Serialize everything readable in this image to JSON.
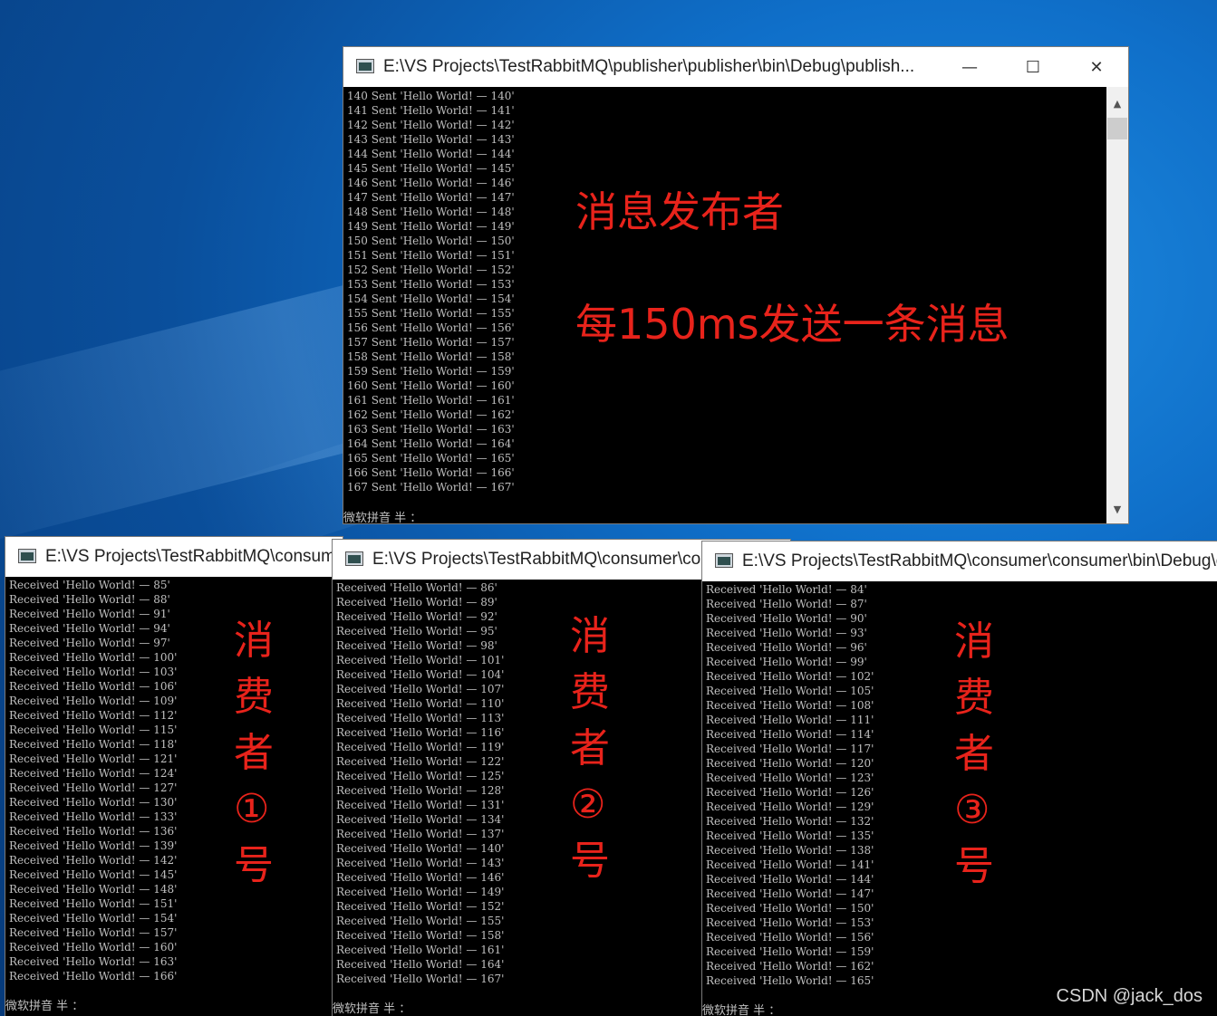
{
  "publisher": {
    "title": "E:\\VS Projects\\TestRabbitMQ\\publisher\\publisher\\bin\\Debug\\publish...",
    "minimize": "—",
    "maximize": "☐",
    "close": "✕",
    "lines": [
      "140 Sent 'Hello World! — 140'",
      "141 Sent 'Hello World! — 141'",
      "142 Sent 'Hello World! — 142'",
      "143 Sent 'Hello World! — 143'",
      "144 Sent 'Hello World! — 144'",
      "145 Sent 'Hello World! — 145'",
      "146 Sent 'Hello World! — 146'",
      "147 Sent 'Hello World! — 147'",
      "148 Sent 'Hello World! — 148'",
      "149 Sent 'Hello World! — 149'",
      "150 Sent 'Hello World! — 150'",
      "151 Sent 'Hello World! — 151'",
      "152 Sent 'Hello World! — 152'",
      "153 Sent 'Hello World! — 153'",
      "154 Sent 'Hello World! — 154'",
      "155 Sent 'Hello World! — 155'",
      "156 Sent 'Hello World! — 156'",
      "157 Sent 'Hello World! — 157'",
      "158 Sent 'Hello World! — 158'",
      "159 Sent 'Hello World! — 159'",
      "160 Sent 'Hello World! — 160'",
      "161 Sent 'Hello World! — 161'",
      "162 Sent 'Hello World! — 162'",
      "163 Sent 'Hello World! — 163'",
      "164 Sent 'Hello World! — 164'",
      "165 Sent 'Hello World! — 165'",
      "166 Sent 'Hello World! — 166'",
      "167 Sent 'Hello World! — 167'"
    ],
    "ime": "微软拼音 半 ：",
    "annotation_title": "消息发布者",
    "annotation_desc": "每150ms发送一条消息"
  },
  "consumer1": {
    "title": "E:\\VS Projects\\TestRabbitMQ\\consumer\\consumer\\bin\\Debug\\consumer.exe",
    "lines": [
      "Received 'Hello World! — 85'",
      "Received 'Hello World! — 88'",
      "Received 'Hello World! — 91'",
      "Received 'Hello World! — 94'",
      "Received 'Hello World! — 97'",
      "Received 'Hello World! — 100'",
      "Received 'Hello World! — 103'",
      "Received 'Hello World! — 106'",
      "Received 'Hello World! — 109'",
      "Received 'Hello World! — 112'",
      "Received 'Hello World! — 115'",
      "Received 'Hello World! — 118'",
      "Received 'Hello World! — 121'",
      "Received 'Hello World! — 124'",
      "Received 'Hello World! — 127'",
      "Received 'Hello World! — 130'",
      "Received 'Hello World! — 133'",
      "Received 'Hello World! — 136'",
      "Received 'Hello World! — 139'",
      "Received 'Hello World! — 142'",
      "Received 'Hello World! — 145'",
      "Received 'Hello World! — 148'",
      "Received 'Hello World! — 151'",
      "Received 'Hello World! — 154'",
      "Received 'Hello World! — 157'",
      "Received 'Hello World! — 160'",
      "Received 'Hello World! — 163'",
      "Received 'Hello World! — 166'"
    ],
    "ime": "微软拼音 半 ：",
    "annotation": [
      "消",
      "费",
      "者",
      "①",
      "号"
    ]
  },
  "consumer2": {
    "title": "E:\\VS Projects\\TestRabbitMQ\\consumer\\consumer\\bin\\Debug\\consumer.exe",
    "lines": [
      "Received 'Hello World! — 86'",
      "Received 'Hello World! — 89'",
      "Received 'Hello World! — 92'",
      "Received 'Hello World! — 95'",
      "Received 'Hello World! — 98'",
      "Received 'Hello World! — 101'",
      "Received 'Hello World! — 104'",
      "Received 'Hello World! — 107'",
      "Received 'Hello World! — 110'",
      "Received 'Hello World! — 113'",
      "Received 'Hello World! — 116'",
      "Received 'Hello World! — 119'",
      "Received 'Hello World! — 122'",
      "Received 'Hello World! — 125'",
      "Received 'Hello World! — 128'",
      "Received 'Hello World! — 131'",
      "Received 'Hello World! — 134'",
      "Received 'Hello World! — 137'",
      "Received 'Hello World! — 140'",
      "Received 'Hello World! — 143'",
      "Received 'Hello World! — 146'",
      "Received 'Hello World! — 149'",
      "Received 'Hello World! — 152'",
      "Received 'Hello World! — 155'",
      "Received 'Hello World! — 158'",
      "Received 'Hello World! — 161'",
      "Received 'Hello World! — 164'",
      "Received 'Hello World! — 167'"
    ],
    "ime": "微软拼音 半 ：",
    "annotation": [
      "消",
      "费",
      "者",
      "②",
      "号"
    ]
  },
  "consumer3": {
    "title": "E:\\VS Projects\\TestRabbitMQ\\consumer\\consumer\\bin\\Debug\\consumer.exe",
    "lines": [
      "Received 'Hello World! — 84'",
      "Received 'Hello World! — 87'",
      "Received 'Hello World! — 90'",
      "Received 'Hello World! — 93'",
      "Received 'Hello World! — 96'",
      "Received 'Hello World! — 99'",
      "Received 'Hello World! — 102'",
      "Received 'Hello World! — 105'",
      "Received 'Hello World! — 108'",
      "Received 'Hello World! — 111'",
      "Received 'Hello World! — 114'",
      "Received 'Hello World! — 117'",
      "Received 'Hello World! — 120'",
      "Received 'Hello World! — 123'",
      "Received 'Hello World! — 126'",
      "Received 'Hello World! — 129'",
      "Received 'Hello World! — 132'",
      "Received 'Hello World! — 135'",
      "Received 'Hello World! — 138'",
      "Received 'Hello World! — 141'",
      "Received 'Hello World! — 144'",
      "Received 'Hello World! — 147'",
      "Received 'Hello World! — 150'",
      "Received 'Hello World! — 153'",
      "Received 'Hello World! — 156'",
      "Received 'Hello World! — 159'",
      "Received 'Hello World! — 162'",
      "Received 'Hello World! — 165'"
    ],
    "ime": "微软拼音 半 ：",
    "annotation": [
      "消",
      "费",
      "者",
      "③",
      "号"
    ]
  },
  "icons": {
    "app": "console-app-icon",
    "scroll_up": "▲",
    "scroll_down": "▼"
  },
  "watermark": "CSDN @jack_dos"
}
